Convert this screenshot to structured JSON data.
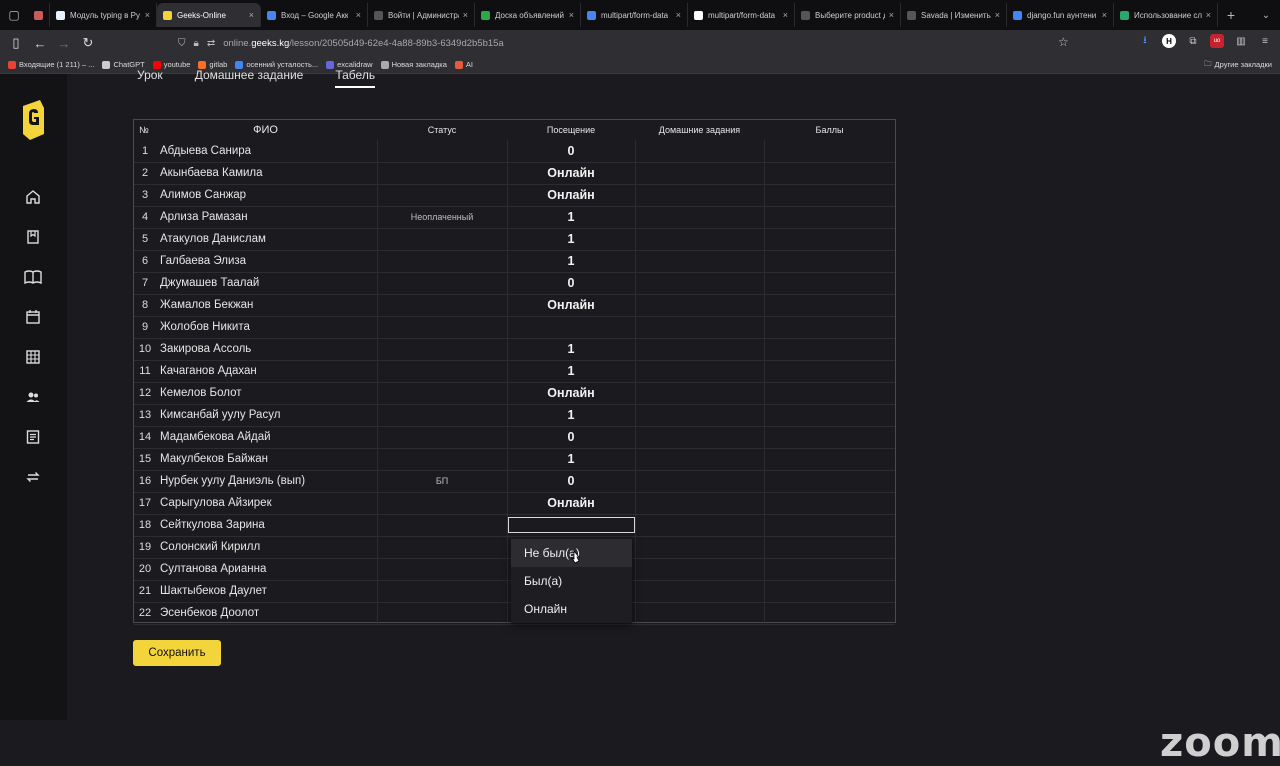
{
  "browser": {
    "tabs": [
      {
        "label": "",
        "color": "#c95b5b"
      },
      {
        "label": "Модуль typing в Py",
        "color": "#e8f0ff"
      },
      {
        "label": "Geeks-Online",
        "color": "#f3d43a",
        "active": true
      },
      {
        "label": "Вход – Google Акк",
        "color": "#4285f4"
      },
      {
        "label": "Войти | Администрати",
        "color": "#555555"
      },
      {
        "label": "Доска объявлений",
        "color": "#2aa84a"
      },
      {
        "label": "multipart/form-data",
        "color": "#4285f4"
      },
      {
        "label": "multipart/form-data",
        "color": "#ffffff"
      },
      {
        "label": "Выберите product для",
        "color": "#555555"
      },
      {
        "label": "Savada | Изменить пол",
        "color": "#555555"
      },
      {
        "label": "django.fun аунтени",
        "color": "#4285f4"
      },
      {
        "label": "Использование сл",
        "color": "#29a86a"
      }
    ],
    "url_prefix": "online.",
    "url_host": "geeks.kg",
    "url_path": "/lesson/20505d49-62e4-4a88-89b3-6349d2b5b15a",
    "bookmarks": [
      {
        "label": "Входящие (1 211) – ...",
        "color": "#ea4335"
      },
      {
        "label": "ChatGPT",
        "color": "#cccccc"
      },
      {
        "label": "youtube",
        "color": "#ff0000"
      },
      {
        "label": "gitlab",
        "color": "#fc6d26"
      },
      {
        "label": "осенний усталость...",
        "color": "#4285f4"
      },
      {
        "label": "excalidraw",
        "color": "#6965db"
      },
      {
        "label": "Новая закладка",
        "color": "#aaaaaa"
      },
      {
        "label": "AI",
        "color": "#e55b3c"
      }
    ],
    "other_bookmarks": "Другие закладки"
  },
  "lesson_tabs": {
    "lesson": "Урок",
    "homework": "Домашнее задание",
    "journal": "Табель"
  },
  "table": {
    "headers": {
      "num": "№",
      "fio": "ФИО",
      "status": "Статус",
      "attendance": "Посещение",
      "homework": "Домашние задания",
      "points": "Баллы"
    },
    "rows": [
      {
        "num": "1",
        "name": "Абдыева Санира",
        "status": "",
        "attendance": "0"
      },
      {
        "num": "2",
        "name": "Акынбаева Камила",
        "status": "",
        "attendance": "Онлайн"
      },
      {
        "num": "3",
        "name": "Алимов Санжар",
        "status": "",
        "attendance": "Онлайн"
      },
      {
        "num": "4",
        "name": "Арлиза Рамазан",
        "status": "Неоплаченный",
        "attendance": "1"
      },
      {
        "num": "5",
        "name": "Атакулов Данислам",
        "status": "",
        "attendance": "1"
      },
      {
        "num": "6",
        "name": "Галбаева Элиза",
        "status": "",
        "attendance": "1"
      },
      {
        "num": "7",
        "name": "Джумашев Таалай",
        "status": "",
        "attendance": "0"
      },
      {
        "num": "8",
        "name": "Жамалов Бекжан",
        "status": "",
        "attendance": "Онлайн"
      },
      {
        "num": "9",
        "name": "Жолобов Никита",
        "status": "",
        "attendance": ""
      },
      {
        "num": "10",
        "name": "Закирова Ассоль",
        "status": "",
        "attendance": "1"
      },
      {
        "num": "11",
        "name": "Качаганов Адахан",
        "status": "",
        "attendance": "1"
      },
      {
        "num": "12",
        "name": "Кемелов Болот",
        "status": "",
        "attendance": "Онлайн"
      },
      {
        "num": "13",
        "name": "Кимсанбай уулу Расул",
        "status": "",
        "attendance": "1"
      },
      {
        "num": "14",
        "name": "Мадамбекова Айдай",
        "status": "",
        "attendance": "0"
      },
      {
        "num": "15",
        "name": "Макулбеков Байжан",
        "status": "",
        "attendance": "1"
      },
      {
        "num": "16",
        "name": "Нурбек уулу Даниэль (вып)",
        "status": "БП",
        "attendance": "0"
      },
      {
        "num": "17",
        "name": "Сарыгулова Айзирек",
        "status": "",
        "attendance": "Онлайн"
      },
      {
        "num": "18",
        "name": "Сейткулова Зарина",
        "status": "",
        "attendance": "",
        "editing": true
      },
      {
        "num": "19",
        "name": "Солонский Кирилл",
        "status": "",
        "attendance": ""
      },
      {
        "num": "20",
        "name": "Султанова Арианна",
        "status": "",
        "attendance": ""
      },
      {
        "num": "21",
        "name": "Шактыбеков Даулет",
        "status": "",
        "attendance": ""
      },
      {
        "num": "22",
        "name": "Эсенбеков Доолот",
        "status": "",
        "attendance": ""
      }
    ]
  },
  "dropdown": {
    "options": [
      "Не был(а)",
      "Был(а)",
      "Онлайн"
    ],
    "hovered": "Не был(а)"
  },
  "save_label": "Сохранить",
  "zoom_watermark": "zoom",
  "colors": {
    "accent": "#f3d43a",
    "background": "#1b1b1f",
    "sidebar": "#131316"
  }
}
